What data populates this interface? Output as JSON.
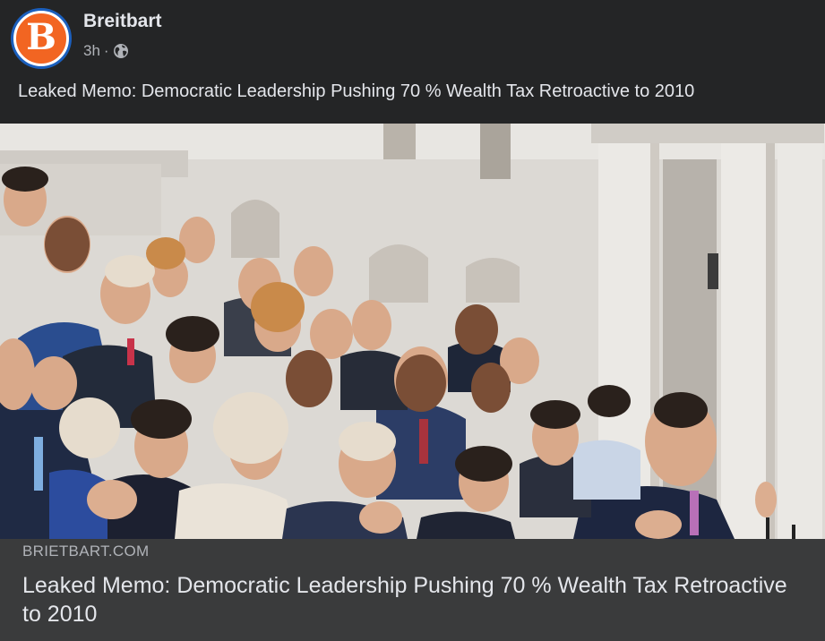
{
  "post": {
    "page_name": "Breitbart",
    "avatar_letter": "B",
    "timestamp": "3h",
    "separator": "·",
    "privacy_icon": "globe-icon",
    "text": "Leaked Memo: Democratic Leadership Pushing 70 % Wealth Tax Retroactive to 2010"
  },
  "link_card": {
    "domain": "BRIETBART.COM",
    "title": "Leaked Memo: Democratic Leadership Pushing 70 % Wealth Tax Retroactive to 2010",
    "image_description_icon": "photo-of-group-on-capitol-steps"
  },
  "colors": {
    "background": "#242526",
    "card_footer": "#3a3b3c",
    "avatar_orange": "#f26522",
    "avatar_ring": "#1b5fbd",
    "text_primary": "#e4e6eb",
    "text_secondary": "#b0b3b8"
  }
}
